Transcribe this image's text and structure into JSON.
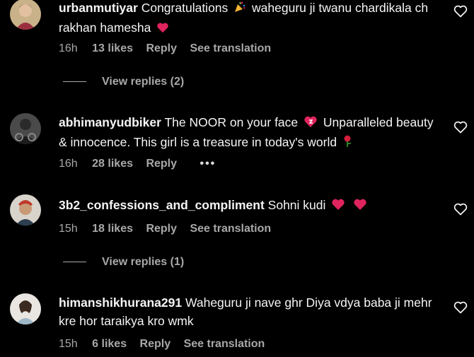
{
  "comments": [
    {
      "username": "urbanmutiyar",
      "text_before": "Congratulations",
      "text_after": "waheguru ji twanu chardikala ch rakhan hamesha",
      "time": "16h",
      "likes": "13 likes",
      "reply": "Reply",
      "translate": "See translation",
      "view_replies": "View replies (2)"
    },
    {
      "username": "abhimanyudbiker",
      "text_before": "The NOOR on your face",
      "text_after": "Unparalleled beauty & innocence. This girl is a treasure in today's world",
      "time": "16h",
      "likes": "28 likes",
      "reply": "Reply",
      "more": "•••"
    },
    {
      "username": "3b2_confessions_and_compliment",
      "text_before": "Sohni kudi",
      "time": "15h",
      "likes": "18 likes",
      "reply": "Reply",
      "translate": "See translation",
      "view_replies": "View replies (1)"
    },
    {
      "username": "himanshikhurana291",
      "text_before": "Waheguru ji nave ghr Diya vdya baba ji mehr kre hor taraikya kro wmk",
      "time": "15h",
      "likes": "6 likes",
      "reply": "Reply",
      "translate": "See translation"
    }
  ],
  "icons": {
    "like": "heart-outline-icon",
    "red_heart": "red-heart-emoji",
    "party": "party-popper-emoji",
    "sparkle_heart": "sparkling-heart-emoji",
    "rose": "rose-emoji"
  },
  "colors": {
    "background": "#000000",
    "text": "#f5f5f5",
    "secondary": "#a8a8a8",
    "emoji_red": "#e0245e"
  }
}
